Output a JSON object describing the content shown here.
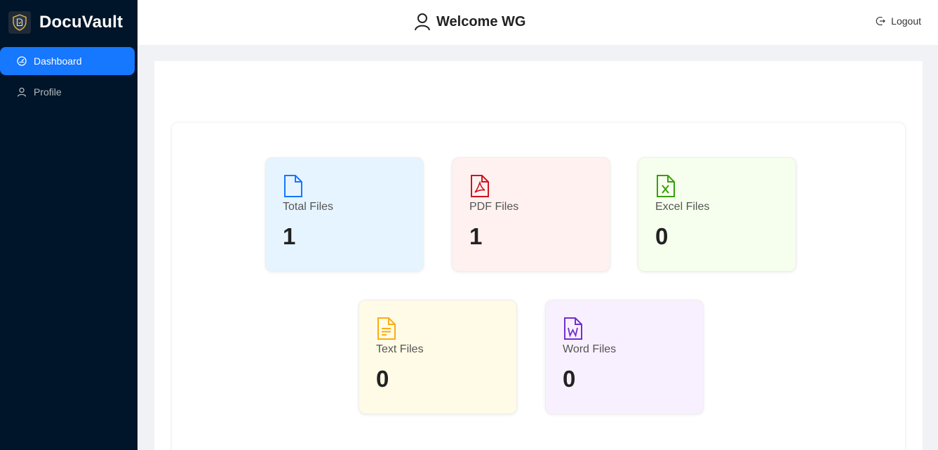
{
  "brand": {
    "name": "DocuVault",
    "logo_icon": "shield-document-icon"
  },
  "sidebar": {
    "items": [
      {
        "label": "Dashboard",
        "icon": "dashboard-icon",
        "active": true
      },
      {
        "label": "Profile",
        "icon": "user-icon",
        "active": false
      }
    ]
  },
  "header": {
    "welcome": "Welcome WG",
    "welcome_icon": "user-icon",
    "logout_label": "Logout",
    "logout_icon": "logout-icon"
  },
  "stats": [
    {
      "label": "Total Files",
      "value": "1",
      "icon": "file-icon",
      "color": "#1677ff",
      "bg": "#e6f4ff"
    },
    {
      "label": "PDF Files",
      "value": "1",
      "icon": "pdf-file-icon",
      "color": "#cf1322",
      "bg": "#fff1f0"
    },
    {
      "label": "Excel Files",
      "value": "0",
      "icon": "excel-file-icon",
      "color": "#389e0d",
      "bg": "#f6ffed"
    },
    {
      "label": "Text Files",
      "value": "0",
      "icon": "text-file-icon",
      "color": "#faad14",
      "bg": "#fffbe6"
    },
    {
      "label": "Word Files",
      "value": "0",
      "icon": "word-file-icon",
      "color": "#722ed1",
      "bg": "#f9f0ff"
    }
  ],
  "colors": {
    "sidebar_bg": "#001529",
    "accent": "#1677ff",
    "page_bg": "#f0f2f5"
  }
}
